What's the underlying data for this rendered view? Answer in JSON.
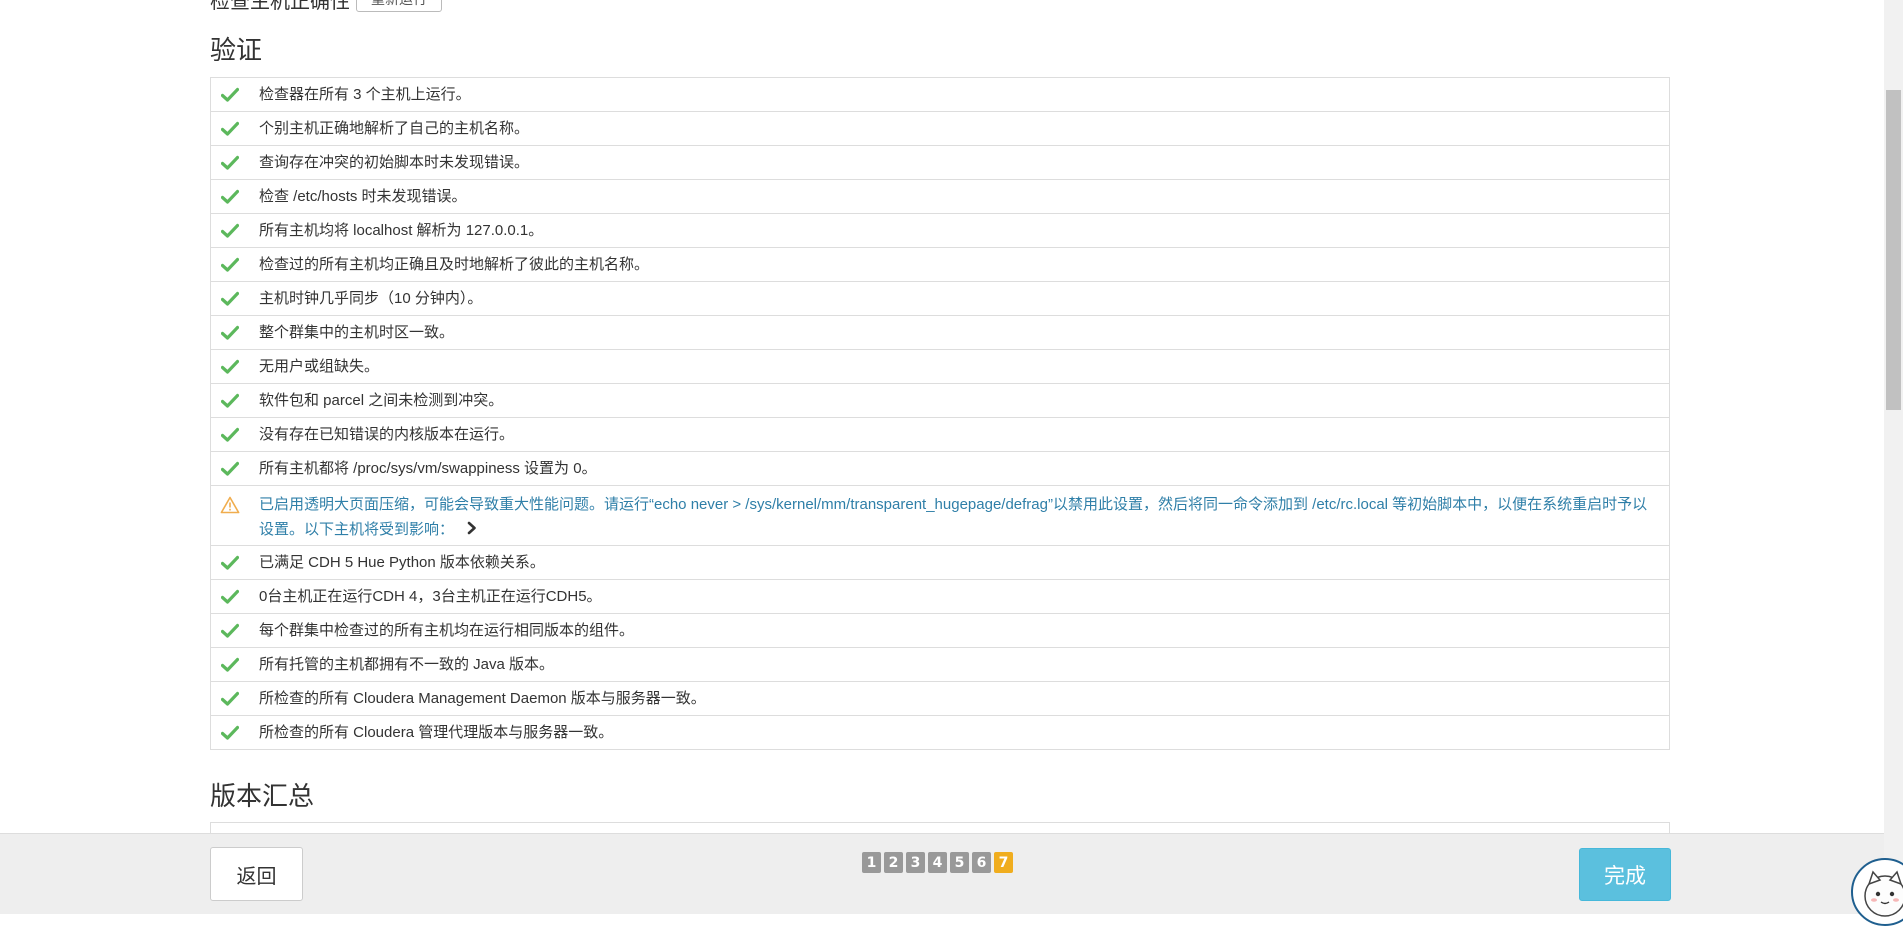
{
  "top_partial": {
    "text": "检查主机正确性",
    "button_label": "重新运行"
  },
  "sections": {
    "verify_title": "验证",
    "version_title": "版本汇总"
  },
  "checks": [
    {
      "status": "ok",
      "text": "检查器在所有 3 个主机上运行。"
    },
    {
      "status": "ok",
      "text": "个别主机正确地解析了自己的主机名称。"
    },
    {
      "status": "ok",
      "text": "查询存在冲突的初始脚本时未发现错误。"
    },
    {
      "status": "ok",
      "text": "检查 /etc/hosts 时未发现错误。"
    },
    {
      "status": "ok",
      "text": "所有主机均将 localhost 解析为 127.0.0.1。"
    },
    {
      "status": "ok",
      "text": "检查过的所有主机均正确且及时地解析了彼此的主机名称。"
    },
    {
      "status": "ok",
      "text": "主机时钟几乎同步（10 分钟内）。"
    },
    {
      "status": "ok",
      "text": "整个群集中的主机时区一致。"
    },
    {
      "status": "ok",
      "text": "无用户或组缺失。"
    },
    {
      "status": "ok",
      "text": "软件包和 parcel 之间未检测到冲突。"
    },
    {
      "status": "ok",
      "text": "没有存在已知错误的内核版本在运行。"
    },
    {
      "status": "ok",
      "text": "所有主机都将 /proc/sys/vm/swappiness 设置为 0。"
    },
    {
      "status": "warn",
      "text": "已启用透明大页面压缩，可能会导致重大性能问题。请运行“echo never > /sys/kernel/mm/transparent_hugepage/defrag”以禁用此设置，然后将同一命令添加到 /etc/rc.local 等初始脚本中，以便在系统重启时予以设置。以下主机将受到影响："
    },
    {
      "status": "ok",
      "text": "已满足 CDH 5 Hue Python 版本依赖关系。"
    },
    {
      "status": "ok",
      "text": "0台主机正在运行CDH 4，3台主机正在运行CDH5。"
    },
    {
      "status": "ok",
      "text": "每个群集中检查过的所有主机均在运行相同版本的组件。"
    },
    {
      "status": "ok",
      "text": "所有托管的主机都拥有不一致的 Java 版本。"
    },
    {
      "status": "ok",
      "text": "所检查的所有 Cloudera Management Daemon 版本与服务器一致。"
    },
    {
      "status": "ok",
      "text": "所检查的所有 Cloudera 管理代理版本与服务器一致。"
    }
  ],
  "footer": {
    "back_label": "返回",
    "finish_label": "完成",
    "steps": [
      "1",
      "2",
      "3",
      "4",
      "5",
      "6",
      "7"
    ],
    "current_step": "7"
  },
  "colors": {
    "ok": "#5cb85c",
    "warn": "#f0ad4e",
    "finish": "#5bc0de",
    "active_step": "#f0ad1e"
  },
  "icons": {
    "ok": "check-icon",
    "warn": "warning-icon",
    "expand": "chevron-right-icon"
  }
}
